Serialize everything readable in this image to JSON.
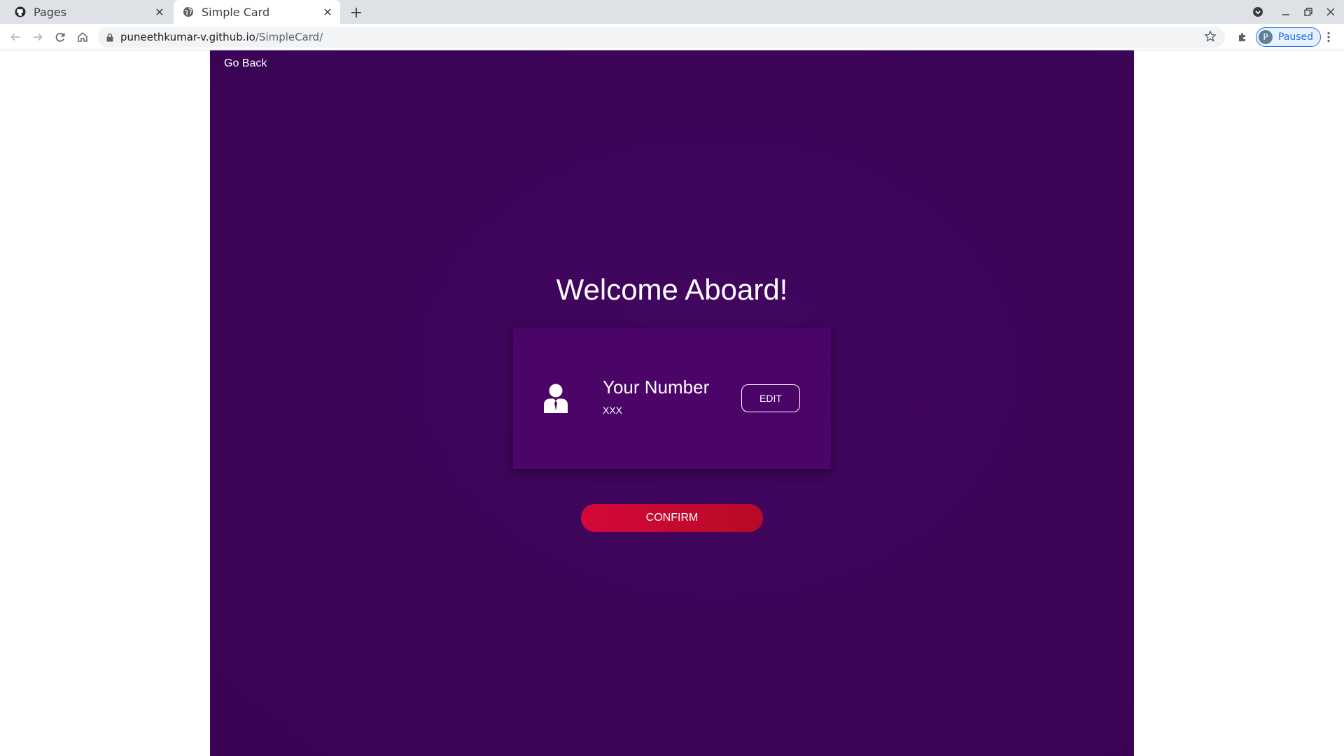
{
  "browser": {
    "tabs": [
      {
        "title": "Pages",
        "icon": "github-icon",
        "active": false
      },
      {
        "title": "Simple Card",
        "icon": "globe-icon",
        "active": true
      }
    ],
    "url_host": "puneethkumar-v.github.io",
    "url_path": "/SimpleCard/",
    "profile_initial": "P",
    "profile_status": "Paused"
  },
  "page": {
    "go_back_label": "Go Back",
    "welcome_title": "Welcome Aboard!",
    "card": {
      "title": "Your Number",
      "value": "XXX",
      "edit_label": "EDIT",
      "avatar_icon": "user-suit-icon"
    },
    "confirm_label": "CONFIRM"
  },
  "colors": {
    "background": "#3d0457",
    "card": "#4b0468",
    "confirm": "#c8092f",
    "text": "#ffffff"
  }
}
